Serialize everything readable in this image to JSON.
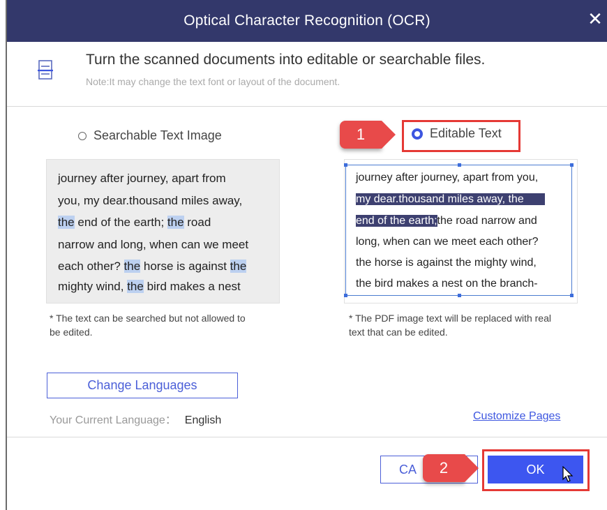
{
  "dialog": {
    "title": "Optical Character Recognition (OCR)",
    "close_glyph": "✕",
    "heading": "Turn the scanned documents into editable or searchable files.",
    "note": "Note:It may change the text font or layout of the document.",
    "icon": "document-icon"
  },
  "options": {
    "searchable": {
      "label": "Searchable Text Image",
      "selected": false,
      "preview_lines": [
        [
          "journey after journey, apart from"
        ],
        [
          "you, my dear.thousand miles away,"
        ],
        [
          "the",
          " end of the earth; ",
          "the",
          " road"
        ],
        [
          "narrow and long, when can we meet"
        ],
        [
          "each other? ",
          "the",
          " horse is against ",
          "the"
        ],
        [
          "mighty wind, ",
          "the",
          " bird makes a nest"
        ]
      ],
      "footnote": "* The text can be searched but not allowed to be edited."
    },
    "editable": {
      "label": "Editable Text",
      "selected": true,
      "preview_lines": [
        [
          "journey after journey, apart from you,"
        ],
        [
          "my dear.thousand miles away, the"
        ],
        [
          "end of the earth;",
          "the road narrow and"
        ],
        [
          "long, when can we meet each other?"
        ],
        [
          "the horse is against the mighty wind,"
        ],
        [
          "the bird makes a nest on the branch-"
        ]
      ],
      "footnote": "* The PDF image text will be replaced with real text that can be edited."
    }
  },
  "language": {
    "button_label": "Change Languages",
    "current_label": "Your Current Language：",
    "current_value": "English"
  },
  "customize_label": "Customize Pages",
  "buttons": {
    "cancel_label": "CA",
    "ok_label": "OK"
  },
  "annotations": {
    "step1": "1",
    "step2": "2",
    "color": "#e84a4a"
  },
  "colors": {
    "titlebar": "#33386b",
    "accent": "#3d56f0",
    "highlight": "#bcd0f0",
    "selection": "#3d4070"
  }
}
